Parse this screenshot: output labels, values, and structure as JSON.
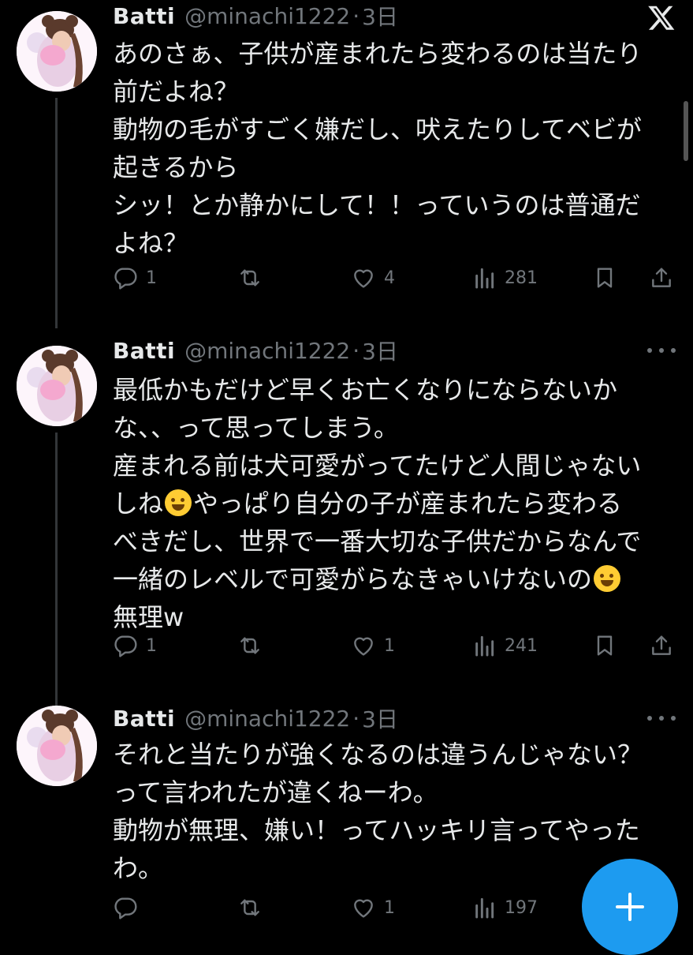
{
  "tweets": [
    {
      "name": "Batti",
      "handle": "@minachi1222",
      "separator": "·",
      "time": "3日",
      "lines": [
        "あのさぁ、子供が産まれたら変わるのは当たり",
        "前だよね？",
        "動物の毛がすごく嫌だし、吠えたりしてベビが",
        "起きるから",
        "シッ！とか静かにして！！っていうのは普通だ",
        "よね？"
      ],
      "replies": "1",
      "retweets": "",
      "likes": "4",
      "views": "281"
    },
    {
      "name": "Batti",
      "handle": "@minachi1222",
      "separator": "·",
      "time": "3日",
      "lines": [
        "最低かもだけど早くお亡くなりにならないか",
        "な、、って思ってしまう。",
        "産まれる前は犬可愛がってたけど人間じゃない",
        "しね",
        "やっぱり自分の子が産まれたら変わる",
        "べきだし、世界で一番大切な子供だからなんで",
        "一緒のレベルで可愛がらなきゃいけないの",
        "無理w"
      ],
      "replies": "1",
      "retweets": "",
      "likes": "1",
      "views": "241"
    },
    {
      "name": "Batti",
      "handle": "@minachi1222",
      "separator": "·",
      "time": "3日",
      "lines": [
        "それと当たりが強くなるのは違うんじゃない？",
        "って言われたが違くねーわ。",
        "動物が無理、嫌い！ってハッキリ言ってやった",
        "わ。"
      ],
      "replies": "",
      "retweets": "",
      "likes": "1",
      "views": "197"
    }
  ],
  "icons": {
    "reply": "speech-bubble-icon",
    "retweet": "retweet-icon",
    "like": "heart-icon",
    "views": "bar-chart-icon",
    "bookmark": "bookmark-icon",
    "share": "share-icon",
    "more": "more-dots-icon",
    "logo": "x-logo-icon",
    "compose": "plus-icon"
  },
  "colors": {
    "background": "#000000",
    "text": "#e7e9ea",
    "muted": "#71767b",
    "accent": "#1d9bf0"
  }
}
